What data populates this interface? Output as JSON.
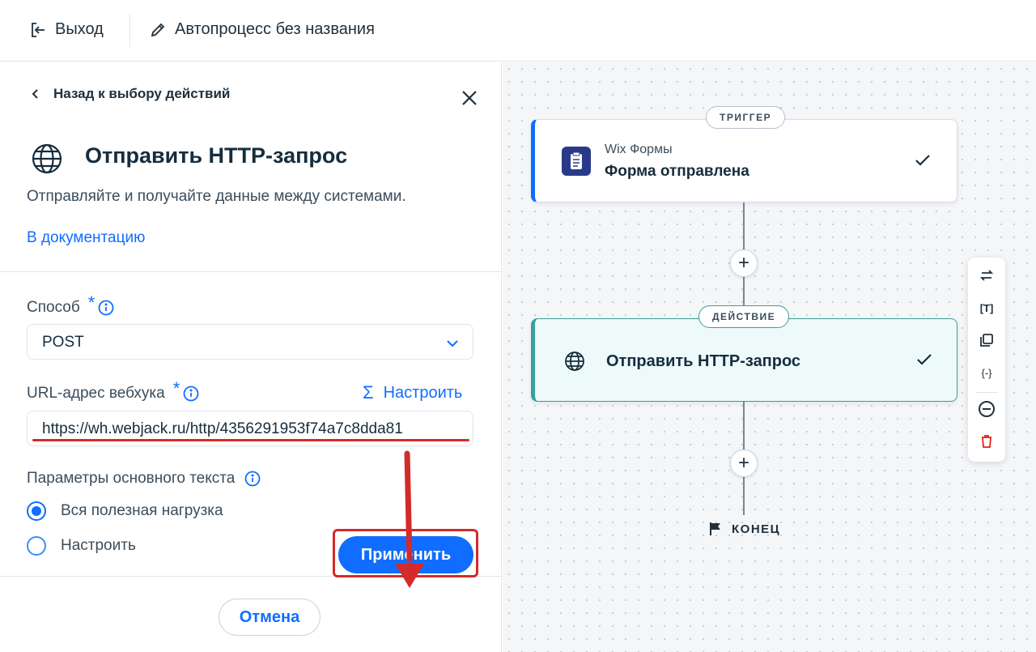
{
  "topbar": {
    "exit_label": "Выход",
    "process_title": "Автопроцесс без названия"
  },
  "panel": {
    "back_label": "Назад к выбору действий",
    "title": "Отправить HTTP-запрос",
    "description": "Отправляйте и получайте данные между системами.",
    "doc_link": "В документацию",
    "method": {
      "label": "Способ",
      "required_mark": "*",
      "value": "POST"
    },
    "webhook": {
      "label": "URL-адрес вебхука",
      "required_mark": "*",
      "customize_symbol": "Σ",
      "customize_label": "Настроить",
      "value": "https://wh.webjack.ru/http/4356291953f74a7c8dda81"
    },
    "body_params": {
      "label": "Параметры основного текста",
      "options": [
        {
          "label": "Вся полезная нагрузка",
          "selected": true
        },
        {
          "label": "Настроить",
          "selected": false
        }
      ]
    },
    "buttons": {
      "cancel": "Отмена",
      "apply": "Применить"
    }
  },
  "canvas": {
    "trigger": {
      "badge": "ТРИГГЕР",
      "app": "Wix Формы",
      "title": "Форма отправлена"
    },
    "action": {
      "badge": "ДЕЙСТВИЕ",
      "title": "Отправить HTTP-запрос"
    },
    "plus_symbol": "+",
    "end_label": "КОНЕЦ",
    "toolbar": {
      "text_icon_label": "[T]",
      "variable_icon_label": "{-}"
    }
  },
  "colors": {
    "accent": "#116dff",
    "action_teal": "#3a9e9c",
    "annotation_red": "#d32a2a",
    "delete_red": "#e62214"
  }
}
